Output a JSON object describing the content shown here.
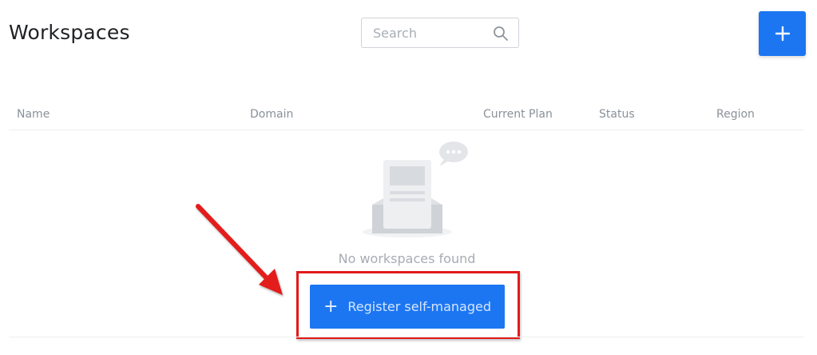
{
  "header": {
    "title": "Workspaces",
    "search_placeholder": "Search",
    "add_icon": "plus-icon"
  },
  "table": {
    "columns": [
      "Name",
      "Domain",
      "Current Plan",
      "Status",
      "Region"
    ]
  },
  "empty_state": {
    "message": "No workspaces found",
    "illustration": "empty-inbox-illustration",
    "button_label": "Register self-managed",
    "button_icon": "plus-icon"
  },
  "colors": {
    "primary": "#1c76f2",
    "annotation": "#e31a1a"
  }
}
